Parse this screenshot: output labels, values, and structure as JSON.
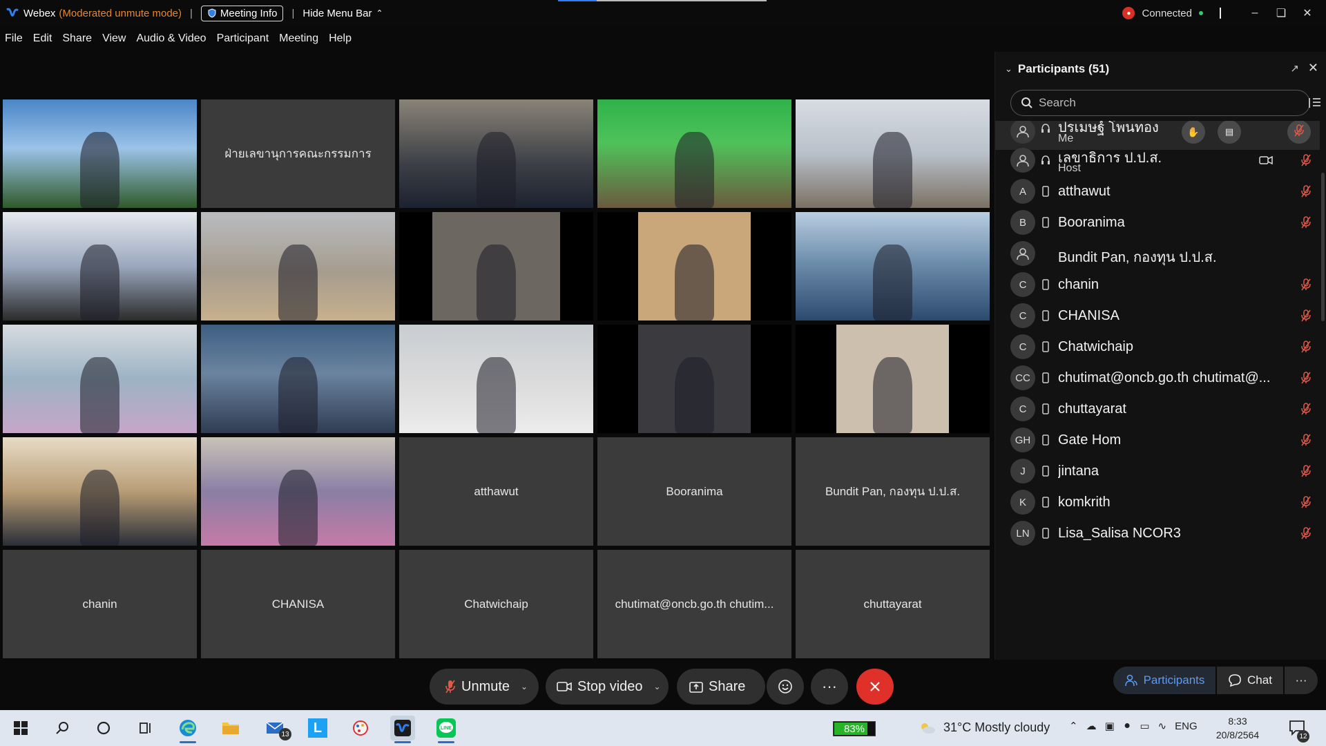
{
  "titlebar": {
    "app_name": "Webex",
    "mode": "(Moderated unmute mode)",
    "meeting_info": "Meeting Info",
    "hide_menu": "Hide Menu Bar",
    "status": "Connected"
  },
  "menu": [
    "File",
    "Edit",
    "Share",
    "View",
    "Audio & Video",
    "Participant",
    "Meeting",
    "Help"
  ],
  "video_grid": {
    "tiles": [
      {
        "type": "video",
        "scene": "outdoor-tower"
      },
      {
        "type": "name",
        "label": "ฝ่ายเลขานุการคณะกรรมการ"
      },
      {
        "type": "video",
        "scene": "man-mask"
      },
      {
        "type": "video",
        "scene": "green-officer"
      },
      {
        "type": "video",
        "scene": "conference-room-blue"
      },
      {
        "type": "video",
        "scene": "boardroom"
      },
      {
        "type": "video",
        "scene": "meeting-table-woman"
      },
      {
        "type": "video",
        "scene": "man-dim"
      },
      {
        "type": "video",
        "scene": "man-closeup"
      },
      {
        "type": "video",
        "scene": "boat"
      },
      {
        "type": "video",
        "scene": "woman-headset"
      },
      {
        "type": "video",
        "scene": "man-suit-desk"
      },
      {
        "type": "video",
        "scene": "man-table"
      },
      {
        "type": "video",
        "scene": "room-dark"
      },
      {
        "type": "video",
        "scene": "man-face"
      },
      {
        "type": "video",
        "scene": "man-office"
      },
      {
        "type": "video",
        "scene": "man-flags"
      },
      {
        "type": "name",
        "label": "atthawut"
      },
      {
        "type": "name",
        "label": "Booranima"
      },
      {
        "type": "name",
        "label": "Bundit Pan, กองทุน ป.ป.ส."
      },
      {
        "type": "name",
        "label": "chanin"
      },
      {
        "type": "name",
        "label": "CHANISA"
      },
      {
        "type": "name",
        "label": "Chatwichaip"
      },
      {
        "type": "name",
        "label": "chutimat@oncb.go.th chutim..."
      },
      {
        "type": "name",
        "label": "chuttayarat"
      }
    ]
  },
  "panel": {
    "title": "Participants (51)",
    "search_placeholder": "Search",
    "participants": [
      {
        "initials": "",
        "name": "ปรเมษฐ์ โพนทอง",
        "role": "Me",
        "muted": true
      },
      {
        "initials": "",
        "name": "เลขาธิการ ป.ป.ส.",
        "role": "Host",
        "muted": true
      },
      {
        "initials": "A",
        "name": "atthawut",
        "role": "",
        "muted": true
      },
      {
        "initials": "B",
        "name": "Booranima",
        "role": "",
        "muted": true
      },
      {
        "initials": "",
        "name": "Bundit Pan, กองทุน ป.ป.ส.",
        "role": "",
        "muted": false
      },
      {
        "initials": "C",
        "name": "chanin",
        "role": "",
        "muted": true
      },
      {
        "initials": "C",
        "name": "CHANISA",
        "role": "",
        "muted": true
      },
      {
        "initials": "C",
        "name": "Chatwichaip",
        "role": "",
        "muted": true
      },
      {
        "initials": "CC",
        "name": "chutimat@oncb.go.th chutimat@...",
        "role": "",
        "muted": true
      },
      {
        "initials": "C",
        "name": "chuttayarat",
        "role": "",
        "muted": true
      },
      {
        "initials": "GH",
        "name": "Gate Hom",
        "role": "",
        "muted": true
      },
      {
        "initials": "J",
        "name": "jintana",
        "role": "",
        "muted": true
      },
      {
        "initials": "K",
        "name": "komkrith",
        "role": "",
        "muted": true
      },
      {
        "initials": "LN",
        "name": "Lisa_Salisa NCOR3",
        "role": "",
        "muted": true
      }
    ],
    "footer": {
      "participants": "Participants",
      "chat": "Chat"
    }
  },
  "controls": {
    "unmute": "Unmute",
    "stop_video": "Stop video",
    "share": "Share"
  },
  "taskbar": {
    "mail_badge": "13",
    "battery": "83%",
    "battery_level": 0.83,
    "weather": "31°C  Mostly cloudy",
    "lang": "ENG",
    "time": "8:33",
    "date": "20/8/2564",
    "notifications": "12"
  },
  "colors": {
    "accent": "#2f80ed",
    "leave": "#e0302a",
    "mute": "#e05a4a",
    "mode": "#e8862a"
  }
}
